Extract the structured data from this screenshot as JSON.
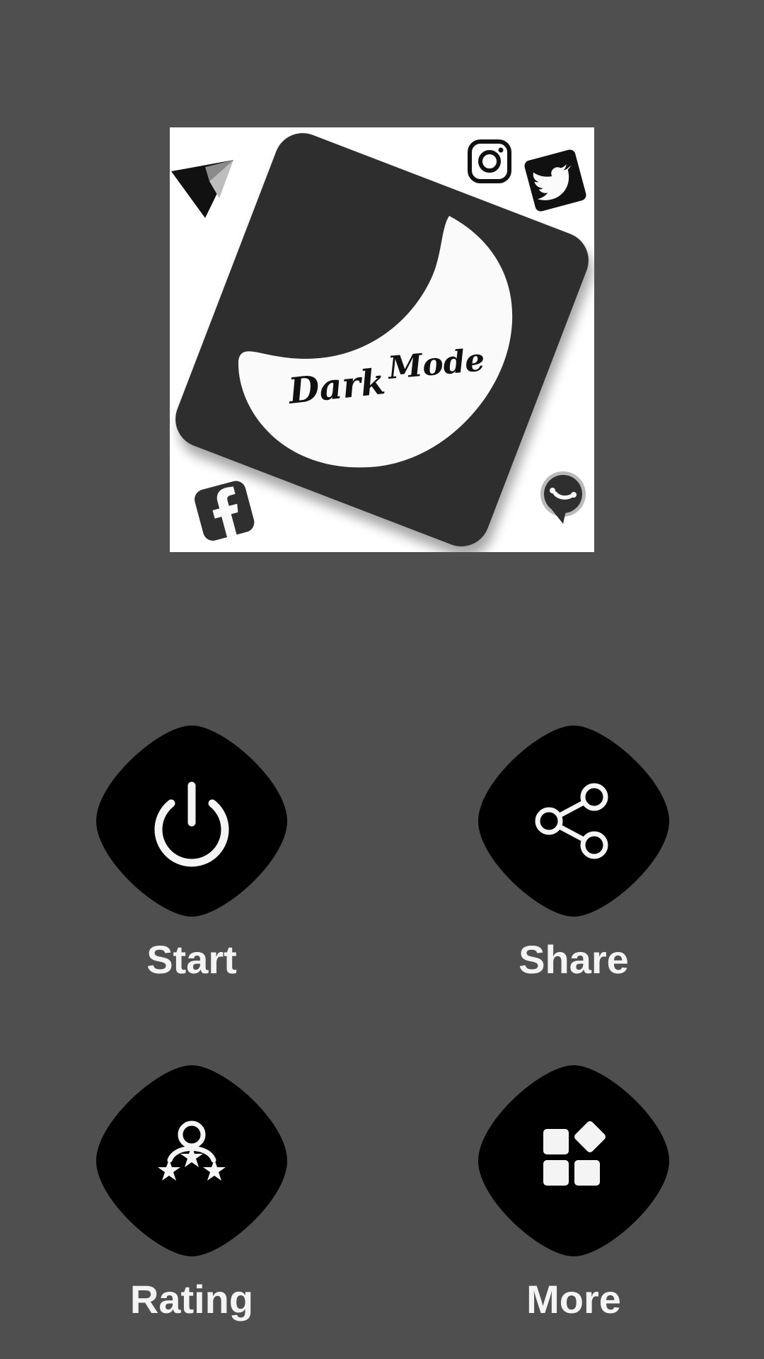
{
  "logo": {
    "line1": "Dark",
    "line2": "Mode",
    "icons": [
      "send-icon",
      "instagram-icon",
      "twitter-icon",
      "facebook-icon",
      "chat-call-icon"
    ]
  },
  "actions": [
    {
      "label": "Start",
      "icon": "power-icon"
    },
    {
      "label": "Share",
      "icon": "share-icon"
    },
    {
      "label": "Rating",
      "icon": "user-rating-icon"
    },
    {
      "label": "More",
      "icon": "apps-grid-icon"
    }
  ],
  "colors": {
    "background": "#4f4f4f",
    "tile": "#000000",
    "text": "#f4f4f4",
    "logo_dark": "#2f2f2f",
    "logo_light": "#fafafa"
  }
}
